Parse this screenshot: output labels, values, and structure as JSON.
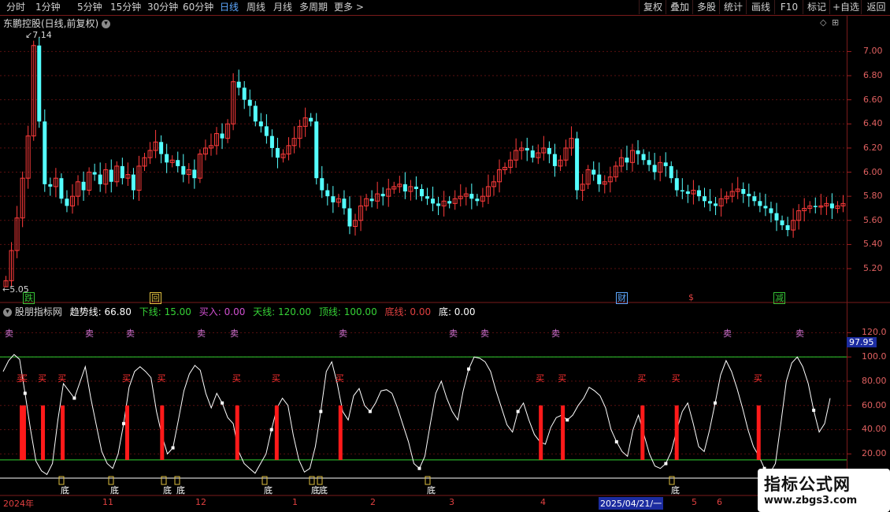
{
  "toolbar": {
    "periods": [
      {
        "label": "分时"
      },
      {
        "label": "1分钟"
      },
      {
        "label": "5分钟"
      },
      {
        "label": "15分钟"
      },
      {
        "label": "30分钟"
      },
      {
        "label": "60分钟"
      },
      {
        "label": "日线"
      },
      {
        "label": "周线"
      },
      {
        "label": "月线"
      },
      {
        "label": "多周期"
      },
      {
        "label": "更多 >"
      }
    ],
    "active_period": "日线",
    "right_buttons": [
      {
        "label": "复权"
      },
      {
        "label": "叠加"
      },
      {
        "label": "多股"
      },
      {
        "label": "统计"
      },
      {
        "label": "画线"
      },
      {
        "label": "F10"
      },
      {
        "label": "标记"
      },
      {
        "label": "+自选"
      },
      {
        "label": "返回"
      }
    ]
  },
  "main_pane": {
    "title": "东鹏控股(日线,前复权)",
    "high_marker": "7.14",
    "low_marker": "5.05",
    "events": [
      {
        "label": "跌",
        "color": "#36c236"
      },
      {
        "label": "回",
        "color": "#e0c040"
      },
      {
        "label": "财",
        "color": "#5ea8ff"
      },
      {
        "label": "$",
        "color": "#e04040"
      },
      {
        "label": "减",
        "color": "#36c236"
      }
    ]
  },
  "indicator_pane": {
    "name": "股朋指标网",
    "items": [
      {
        "label": "趋势线: 66.80",
        "color": "#ffffff"
      },
      {
        "label": "下线: 15.00",
        "color": "#36d236"
      },
      {
        "label": "买入: 0.00",
        "color": "#d050d0"
      },
      {
        "label": "天线: 120.00",
        "color": "#36d236"
      },
      {
        "label": "顶线: 100.00",
        "color": "#36d236"
      },
      {
        "label": "底线: 0.00",
        "color": "#e04040"
      },
      {
        "label": "底: 0.00",
        "color": "#ffffff"
      }
    ],
    "highlight_value": "97.95",
    "sell_label": "卖",
    "buy_label": "买",
    "bottom_label": "底"
  },
  "price_axis": [
    "7.00",
    "6.80",
    "6.60",
    "6.40",
    "6.20",
    "6.00",
    "5.80",
    "5.60",
    "5.40",
    "5.20"
  ],
  "indicator_axis": [
    "120.0",
    "100.0",
    "80.00",
    "60.00",
    "40.00",
    "20.00"
  ],
  "date_axis": [
    {
      "label": "2024年",
      "hl": false
    },
    {
      "label": "11",
      "hl": false
    },
    {
      "label": "12",
      "hl": false
    },
    {
      "label": "1",
      "hl": false
    },
    {
      "label": "2",
      "hl": false
    },
    {
      "label": "3",
      "hl": false
    },
    {
      "label": "4",
      "hl": false
    },
    {
      "label": "2025/04/21/一",
      "hl": true
    },
    {
      "label": "5",
      "hl": false
    },
    {
      "label": "6",
      "hl": false
    }
  ],
  "watermark": {
    "big": "指标公式网",
    "small": "www.zbgs3.com"
  },
  "chart_data": [
    {
      "type": "candlestick",
      "title": "东鹏控股(日线,前复权)",
      "ylim": [
        5.05,
        7.14
      ],
      "y_ticks": [
        5.2,
        5.4,
        5.6,
        5.8,
        6.0,
        6.2,
        6.4,
        6.6,
        6.8,
        7.0
      ],
      "x_ticks": [
        "2024年",
        "11",
        "12",
        "1",
        "2",
        "3",
        "4",
        "5",
        "6"
      ],
      "close": [
        5.1,
        5.35,
        5.62,
        5.95,
        6.3,
        7.05,
        6.42,
        5.9,
        5.88,
        5.95,
        5.78,
        5.72,
        5.8,
        5.92,
        5.85,
        6.0,
        5.98,
        5.9,
        6.02,
        5.92,
        6.05,
        5.95,
        5.98,
        5.85,
        6.05,
        6.12,
        6.18,
        6.25,
        6.15,
        6.08,
        6.1,
        6.05,
        5.98,
        6.02,
        5.95,
        6.15,
        6.2,
        6.22,
        6.32,
        6.28,
        6.4,
        6.75,
        6.7,
        6.6,
        6.55,
        6.42,
        6.38,
        6.3,
        6.2,
        6.12,
        6.15,
        6.22,
        6.28,
        6.38,
        6.45,
        6.42,
        5.95,
        5.85,
        5.8,
        5.75,
        5.78,
        5.7,
        5.55,
        5.6,
        5.72,
        5.78,
        5.76,
        5.82,
        5.8,
        5.86,
        5.88,
        5.9,
        5.84,
        5.88,
        5.86,
        5.8,
        5.78,
        5.74,
        5.72,
        5.76,
        5.74,
        5.78,
        5.8,
        5.82,
        5.78,
        5.76,
        5.8,
        5.88,
        5.92,
        6.02,
        6.04,
        6.1,
        6.18,
        6.2,
        6.18,
        6.12,
        6.16,
        6.2,
        6.15,
        6.05,
        6.1,
        6.2,
        6.28,
        5.85,
        5.9,
        6.02,
        5.98,
        5.9,
        5.92,
        5.96,
        6.05,
        6.12,
        6.08,
        6.18,
        6.15,
        6.1,
        6.06,
        6.0,
        6.08,
        6.05,
        5.95,
        5.85,
        5.84,
        5.82,
        5.85,
        5.8,
        5.76,
        5.74,
        5.72,
        5.78,
        5.8,
        5.84,
        5.86,
        5.82,
        5.8,
        5.76,
        5.72,
        5.7,
        5.66,
        5.6,
        5.56,
        5.52,
        5.6,
        5.68,
        5.7,
        5.72,
        5.71,
        5.72,
        5.74,
        5.7,
        5.72,
        5.74
      ]
    },
    {
      "type": "line",
      "title": "股朋指标网",
      "ylim": [
        0,
        130
      ],
      "y_ticks": [
        20,
        40,
        60,
        80,
        100,
        120
      ],
      "series": [
        {
          "name": "趋势线",
          "values": [
            88,
            97,
            102,
            98,
            70,
            40,
            14,
            6,
            3,
            12,
            48,
            78,
            72,
            66,
            79,
            92,
            66,
            44,
            22,
            12,
            8,
            20,
            45,
            75,
            88,
            92,
            88,
            83,
            55,
            35,
            20,
            25,
            48,
            72,
            86,
            93,
            89,
            70,
            58,
            70,
            62,
            50,
            45,
            22,
            12,
            8,
            4,
            12,
            20,
            40,
            58,
            66,
            60,
            35,
            15,
            5,
            8,
            26,
            55,
            88,
            96,
            78,
            55,
            48,
            68,
            74,
            60,
            55,
            62,
            72,
            73,
            70,
            58,
            44,
            30,
            12,
            8,
            18,
            45,
            70,
            80,
            66,
            55,
            48,
            72,
            90,
            100,
            99,
            96,
            88,
            72,
            58,
            44,
            38,
            55,
            62,
            48,
            36,
            30,
            28,
            42,
            50,
            52,
            48,
            52,
            60,
            66,
            75,
            72,
            68,
            58,
            40,
            30,
            22,
            18,
            40,
            52,
            36,
            20,
            10,
            8,
            12,
            22,
            40,
            55,
            62,
            45,
            26,
            22,
            40,
            62,
            85,
            97,
            88,
            74,
            58,
            40,
            26,
            18,
            8,
            4,
            12,
            45,
            80,
            95,
            100,
            92,
            78,
            56,
            38,
            45,
            66
          ]
        }
      ],
      "reference_lines": [
        {
          "name": "顶线",
          "value": 100
        },
        {
          "name": "下线",
          "value": 15
        },
        {
          "name": "底线",
          "value": 0
        }
      ],
      "buy_bars": [
        26,
        29,
        54,
        80,
        165,
        211,
        310,
        362,
        446,
        710,
        739,
        844,
        889,
        997
      ],
      "sell_markers": [
        "卖",
        "卖",
        "卖",
        "卖",
        "卖",
        "卖",
        "卖",
        "卖",
        "卖",
        "卖"
      ]
    }
  ]
}
